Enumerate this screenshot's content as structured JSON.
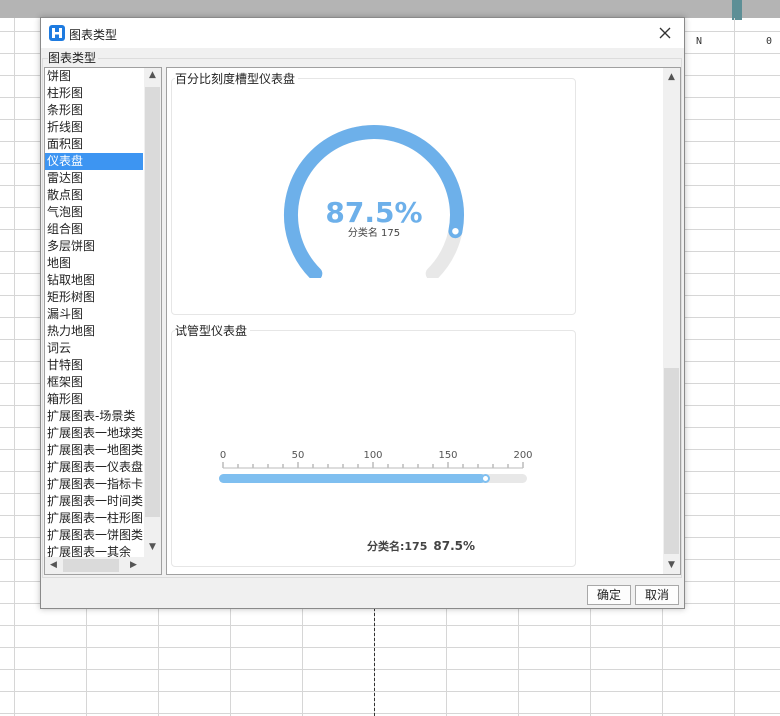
{
  "spreadsheet": {
    "cell_labels": [
      "N",
      "0"
    ]
  },
  "dialog": {
    "title": "图表类型",
    "group_label": "图表类型",
    "close_icon": "close-icon",
    "chart_types": [
      "饼图",
      "柱形图",
      "条形图",
      "折线图",
      "面积图",
      "仪表盘",
      "雷达图",
      "散点图",
      "气泡图",
      "组合图",
      "多层饼图",
      "地图",
      "钻取地图",
      "矩形树图",
      "漏斗图",
      "热力地图",
      "词云",
      "甘特图",
      "框架图",
      "箱形图",
      "扩展图表-场景类",
      "扩展图表一地球类",
      "扩展图表一地图类",
      "扩展图表一仪表盘",
      "扩展图表一指标卡",
      "扩展图表一时间类",
      "扩展图表一柱形图",
      "扩展图表一饼图类",
      "扩展图表一其余"
    ],
    "selected_type": "仪表盘",
    "ok_label": "确定",
    "cancel_label": "取消"
  },
  "preview": {
    "gauge": {
      "title": "百分比刻度槽型仪表盘",
      "value_text": "87.5%",
      "sub_label": "分类名  175",
      "percent": 0.875,
      "track_color": "#e8e8e8",
      "fill_color": "#6db0ea"
    },
    "tube": {
      "title": "试管型仪表盘",
      "ticks": [
        "0",
        "50",
        "100",
        "150",
        "200"
      ],
      "max": 200,
      "value": 175,
      "category_label": "分类名:175",
      "percent_text": "87.5%",
      "fill_color": "#7fbff0",
      "track_color": "#e8e8e8"
    }
  }
}
